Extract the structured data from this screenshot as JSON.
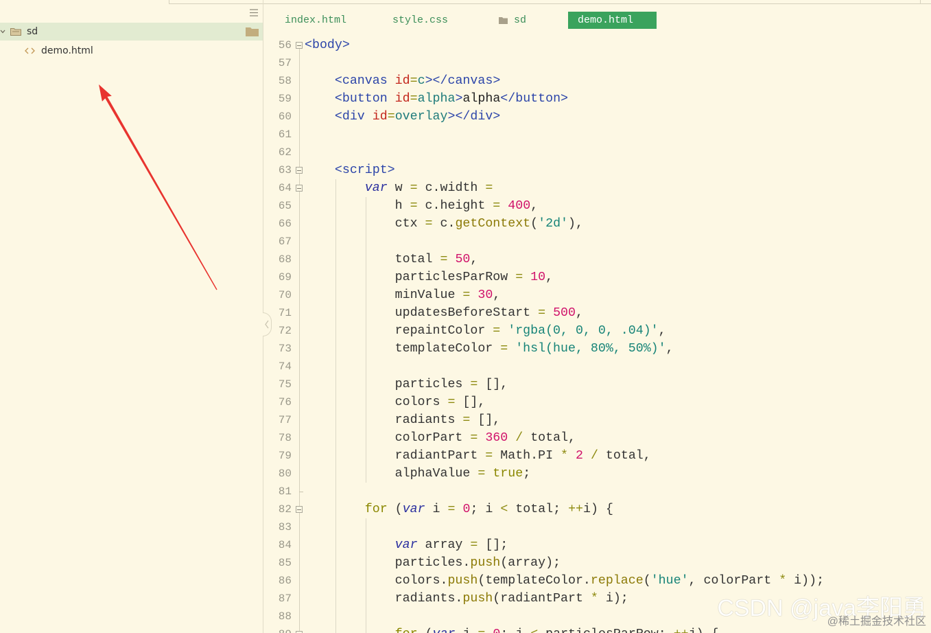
{
  "colors": {
    "background": "#fdf8e4",
    "selected_row": "#e2ebd1",
    "active_tab": "#3aa35d",
    "tab_text": "#3d8f5a",
    "annotation_arrow": "#e8342f"
  },
  "sidebar": {
    "menu_icon": "menu-icon",
    "tree": [
      {
        "label": "sd",
        "type": "folder",
        "expanded": true,
        "selected": true,
        "icon": "folder-icon"
      },
      {
        "label": "demo.html",
        "type": "file",
        "icon": "code-file-icon"
      }
    ]
  },
  "editor": {
    "tabs": [
      {
        "label": "index.html",
        "active": false
      },
      {
        "label": "style.css",
        "active": false
      },
      {
        "label": "sd",
        "active": false,
        "icon": "folder-icon"
      },
      {
        "label": "demo.html",
        "active": true
      }
    ],
    "lines": [
      {
        "n": "56",
        "fold": true,
        "tokens": [
          {
            "t": "<body>",
            "k": "tag"
          }
        ]
      },
      {
        "n": "57",
        "tokens": []
      },
      {
        "n": "58",
        "tokens": [
          {
            "t": "    ",
            "k": "id"
          },
          {
            "t": "<canvas ",
            "k": "tag"
          },
          {
            "t": "id",
            "k": "attr"
          },
          {
            "t": "=",
            "k": "op"
          },
          {
            "t": "c",
            "k": "aval"
          },
          {
            "t": "></canvas>",
            "k": "tag"
          }
        ]
      },
      {
        "n": "59",
        "tokens": [
          {
            "t": "    ",
            "k": "id"
          },
          {
            "t": "<button ",
            "k": "tag"
          },
          {
            "t": "id",
            "k": "attr"
          },
          {
            "t": "=",
            "k": "op"
          },
          {
            "t": "alpha",
            "k": "aval"
          },
          {
            "t": ">",
            "k": "tag"
          },
          {
            "t": "alpha",
            "k": "text"
          },
          {
            "t": "</button>",
            "k": "tag"
          }
        ]
      },
      {
        "n": "60",
        "tokens": [
          {
            "t": "    ",
            "k": "id"
          },
          {
            "t": "<div ",
            "k": "tag"
          },
          {
            "t": "id",
            "k": "attr"
          },
          {
            "t": "=",
            "k": "op"
          },
          {
            "t": "overlay",
            "k": "aval"
          },
          {
            "t": "></div>",
            "k": "tag"
          }
        ]
      },
      {
        "n": "61",
        "tokens": []
      },
      {
        "n": "62",
        "tokens": []
      },
      {
        "n": "63",
        "fold": true,
        "tokens": [
          {
            "t": "    ",
            "k": "id"
          },
          {
            "t": "<script>",
            "k": "tag"
          }
        ]
      },
      {
        "n": "64",
        "fold": true,
        "tokens": [
          {
            "t": "        ",
            "k": "id"
          },
          {
            "t": "var",
            "k": "kw"
          },
          {
            "t": " w ",
            "k": "id"
          },
          {
            "t": "=",
            "k": "op"
          },
          {
            "t": " c.width ",
            "k": "id"
          },
          {
            "t": "=",
            "k": "op"
          }
        ]
      },
      {
        "n": "65",
        "tokens": [
          {
            "t": "            h ",
            "k": "id"
          },
          {
            "t": "=",
            "k": "op"
          },
          {
            "t": " c.height ",
            "k": "id"
          },
          {
            "t": "=",
            "k": "op"
          },
          {
            "t": " ",
            "k": "id"
          },
          {
            "t": "400",
            "k": "num"
          },
          {
            "t": ",",
            "k": "id"
          }
        ]
      },
      {
        "n": "66",
        "tokens": [
          {
            "t": "            ctx ",
            "k": "id"
          },
          {
            "t": "=",
            "k": "op"
          },
          {
            "t": " c.",
            "k": "id"
          },
          {
            "t": "getContext",
            "k": "fn"
          },
          {
            "t": "(",
            "k": "id"
          },
          {
            "t": "'2d'",
            "k": "str"
          },
          {
            "t": "),",
            "k": "id"
          }
        ]
      },
      {
        "n": "67",
        "tokens": []
      },
      {
        "n": "68",
        "tokens": [
          {
            "t": "            total ",
            "k": "id"
          },
          {
            "t": "=",
            "k": "op"
          },
          {
            "t": " ",
            "k": "id"
          },
          {
            "t": "50",
            "k": "num"
          },
          {
            "t": ",",
            "k": "id"
          }
        ]
      },
      {
        "n": "69",
        "tokens": [
          {
            "t": "            particlesParRow ",
            "k": "id"
          },
          {
            "t": "=",
            "k": "op"
          },
          {
            "t": " ",
            "k": "id"
          },
          {
            "t": "10",
            "k": "num"
          },
          {
            "t": ",",
            "k": "id"
          }
        ]
      },
      {
        "n": "70",
        "tokens": [
          {
            "t": "            minValue ",
            "k": "id"
          },
          {
            "t": "=",
            "k": "op"
          },
          {
            "t": " ",
            "k": "id"
          },
          {
            "t": "30",
            "k": "num"
          },
          {
            "t": ",",
            "k": "id"
          }
        ]
      },
      {
        "n": "71",
        "tokens": [
          {
            "t": "            updatesBeforeStart ",
            "k": "id"
          },
          {
            "t": "=",
            "k": "op"
          },
          {
            "t": " ",
            "k": "id"
          },
          {
            "t": "500",
            "k": "num"
          },
          {
            "t": ",",
            "k": "id"
          }
        ]
      },
      {
        "n": "72",
        "tokens": [
          {
            "t": "            repaintColor ",
            "k": "id"
          },
          {
            "t": "=",
            "k": "op"
          },
          {
            "t": " ",
            "k": "id"
          },
          {
            "t": "'rgba(0, 0, 0, .04)'",
            "k": "str"
          },
          {
            "t": ",",
            "k": "id"
          }
        ]
      },
      {
        "n": "73",
        "tokens": [
          {
            "t": "            templateColor ",
            "k": "id"
          },
          {
            "t": "=",
            "k": "op"
          },
          {
            "t": " ",
            "k": "id"
          },
          {
            "t": "'hsl(hue, 80%, 50%)'",
            "k": "str"
          },
          {
            "t": ",",
            "k": "id"
          }
        ]
      },
      {
        "n": "74",
        "tokens": []
      },
      {
        "n": "75",
        "tokens": [
          {
            "t": "            particles ",
            "k": "id"
          },
          {
            "t": "=",
            "k": "op"
          },
          {
            "t": " [],",
            "k": "id"
          }
        ]
      },
      {
        "n": "76",
        "tokens": [
          {
            "t": "            colors ",
            "k": "id"
          },
          {
            "t": "=",
            "k": "op"
          },
          {
            "t": " [],",
            "k": "id"
          }
        ]
      },
      {
        "n": "77",
        "tokens": [
          {
            "t": "            radiants ",
            "k": "id"
          },
          {
            "t": "=",
            "k": "op"
          },
          {
            "t": " [],",
            "k": "id"
          }
        ]
      },
      {
        "n": "78",
        "tokens": [
          {
            "t": "            colorPart ",
            "k": "id"
          },
          {
            "t": "=",
            "k": "op"
          },
          {
            "t": " ",
            "k": "id"
          },
          {
            "t": "360",
            "k": "num"
          },
          {
            "t": " ",
            "k": "id"
          },
          {
            "t": "/",
            "k": "op"
          },
          {
            "t": " total,",
            "k": "id"
          }
        ]
      },
      {
        "n": "79",
        "tokens": [
          {
            "t": "            radiantPart ",
            "k": "id"
          },
          {
            "t": "=",
            "k": "op"
          },
          {
            "t": " Math.PI ",
            "k": "id"
          },
          {
            "t": "*",
            "k": "op"
          },
          {
            "t": " ",
            "k": "id"
          },
          {
            "t": "2",
            "k": "num"
          },
          {
            "t": " ",
            "k": "id"
          },
          {
            "t": "/",
            "k": "op"
          },
          {
            "t": " total,",
            "k": "id"
          }
        ]
      },
      {
        "n": "80",
        "tokens": [
          {
            "t": "            alphaValue ",
            "k": "id"
          },
          {
            "t": "=",
            "k": "op"
          },
          {
            "t": " ",
            "k": "id"
          },
          {
            "t": "true",
            "k": "ctrl"
          },
          {
            "t": ";",
            "k": "id"
          }
        ]
      },
      {
        "n": "81",
        "fold_end": true,
        "tokens": []
      },
      {
        "n": "82",
        "fold": true,
        "tokens": [
          {
            "t": "        ",
            "k": "id"
          },
          {
            "t": "for",
            "k": "ctrl"
          },
          {
            "t": " (",
            "k": "id"
          },
          {
            "t": "var",
            "k": "kw"
          },
          {
            "t": " i ",
            "k": "id"
          },
          {
            "t": "=",
            "k": "op"
          },
          {
            "t": " ",
            "k": "id"
          },
          {
            "t": "0",
            "k": "num"
          },
          {
            "t": "; i ",
            "k": "id"
          },
          {
            "t": "<",
            "k": "op"
          },
          {
            "t": " total; ",
            "k": "id"
          },
          {
            "t": "++",
            "k": "op"
          },
          {
            "t": "i) {",
            "k": "id"
          }
        ]
      },
      {
        "n": "83",
        "tokens": []
      },
      {
        "n": "84",
        "tokens": [
          {
            "t": "            ",
            "k": "id"
          },
          {
            "t": "var",
            "k": "kw"
          },
          {
            "t": " array ",
            "k": "id"
          },
          {
            "t": "=",
            "k": "op"
          },
          {
            "t": " [];",
            "k": "id"
          }
        ]
      },
      {
        "n": "85",
        "tokens": [
          {
            "t": "            particles.",
            "k": "id"
          },
          {
            "t": "push",
            "k": "fn"
          },
          {
            "t": "(array);",
            "k": "id"
          }
        ]
      },
      {
        "n": "86",
        "tokens": [
          {
            "t": "            colors.",
            "k": "id"
          },
          {
            "t": "push",
            "k": "fn"
          },
          {
            "t": "(templateColor.",
            "k": "id"
          },
          {
            "t": "replace",
            "k": "fn"
          },
          {
            "t": "(",
            "k": "id"
          },
          {
            "t": "'hue'",
            "k": "str"
          },
          {
            "t": ", colorPart ",
            "k": "id"
          },
          {
            "t": "*",
            "k": "op"
          },
          {
            "t": " i));",
            "k": "id"
          }
        ]
      },
      {
        "n": "87",
        "tokens": [
          {
            "t": "            radiants.",
            "k": "id"
          },
          {
            "t": "push",
            "k": "fn"
          },
          {
            "t": "(radiantPart ",
            "k": "id"
          },
          {
            "t": "*",
            "k": "op"
          },
          {
            "t": " i);",
            "k": "id"
          }
        ]
      },
      {
        "n": "88",
        "tokens": []
      },
      {
        "n": "89",
        "fold": true,
        "tokens": [
          {
            "t": "            ",
            "k": "id"
          },
          {
            "t": "for",
            "k": "ctrl"
          },
          {
            "t": " (",
            "k": "id"
          },
          {
            "t": "var",
            "k": "kw"
          },
          {
            "t": " j ",
            "k": "id"
          },
          {
            "t": "=",
            "k": "op"
          },
          {
            "t": " ",
            "k": "id"
          },
          {
            "t": "0",
            "k": "num"
          },
          {
            "t": "; j ",
            "k": "id"
          },
          {
            "t": "<",
            "k": "op"
          },
          {
            "t": " particlesParRow; ",
            "k": "id"
          },
          {
            "t": "++",
            "k": "op"
          },
          {
            "t": "j) {",
            "k": "id"
          }
        ]
      }
    ]
  },
  "watermark": {
    "main": "CSDN @java李阳勇",
    "sub": "@稀土掘金技术社区"
  }
}
